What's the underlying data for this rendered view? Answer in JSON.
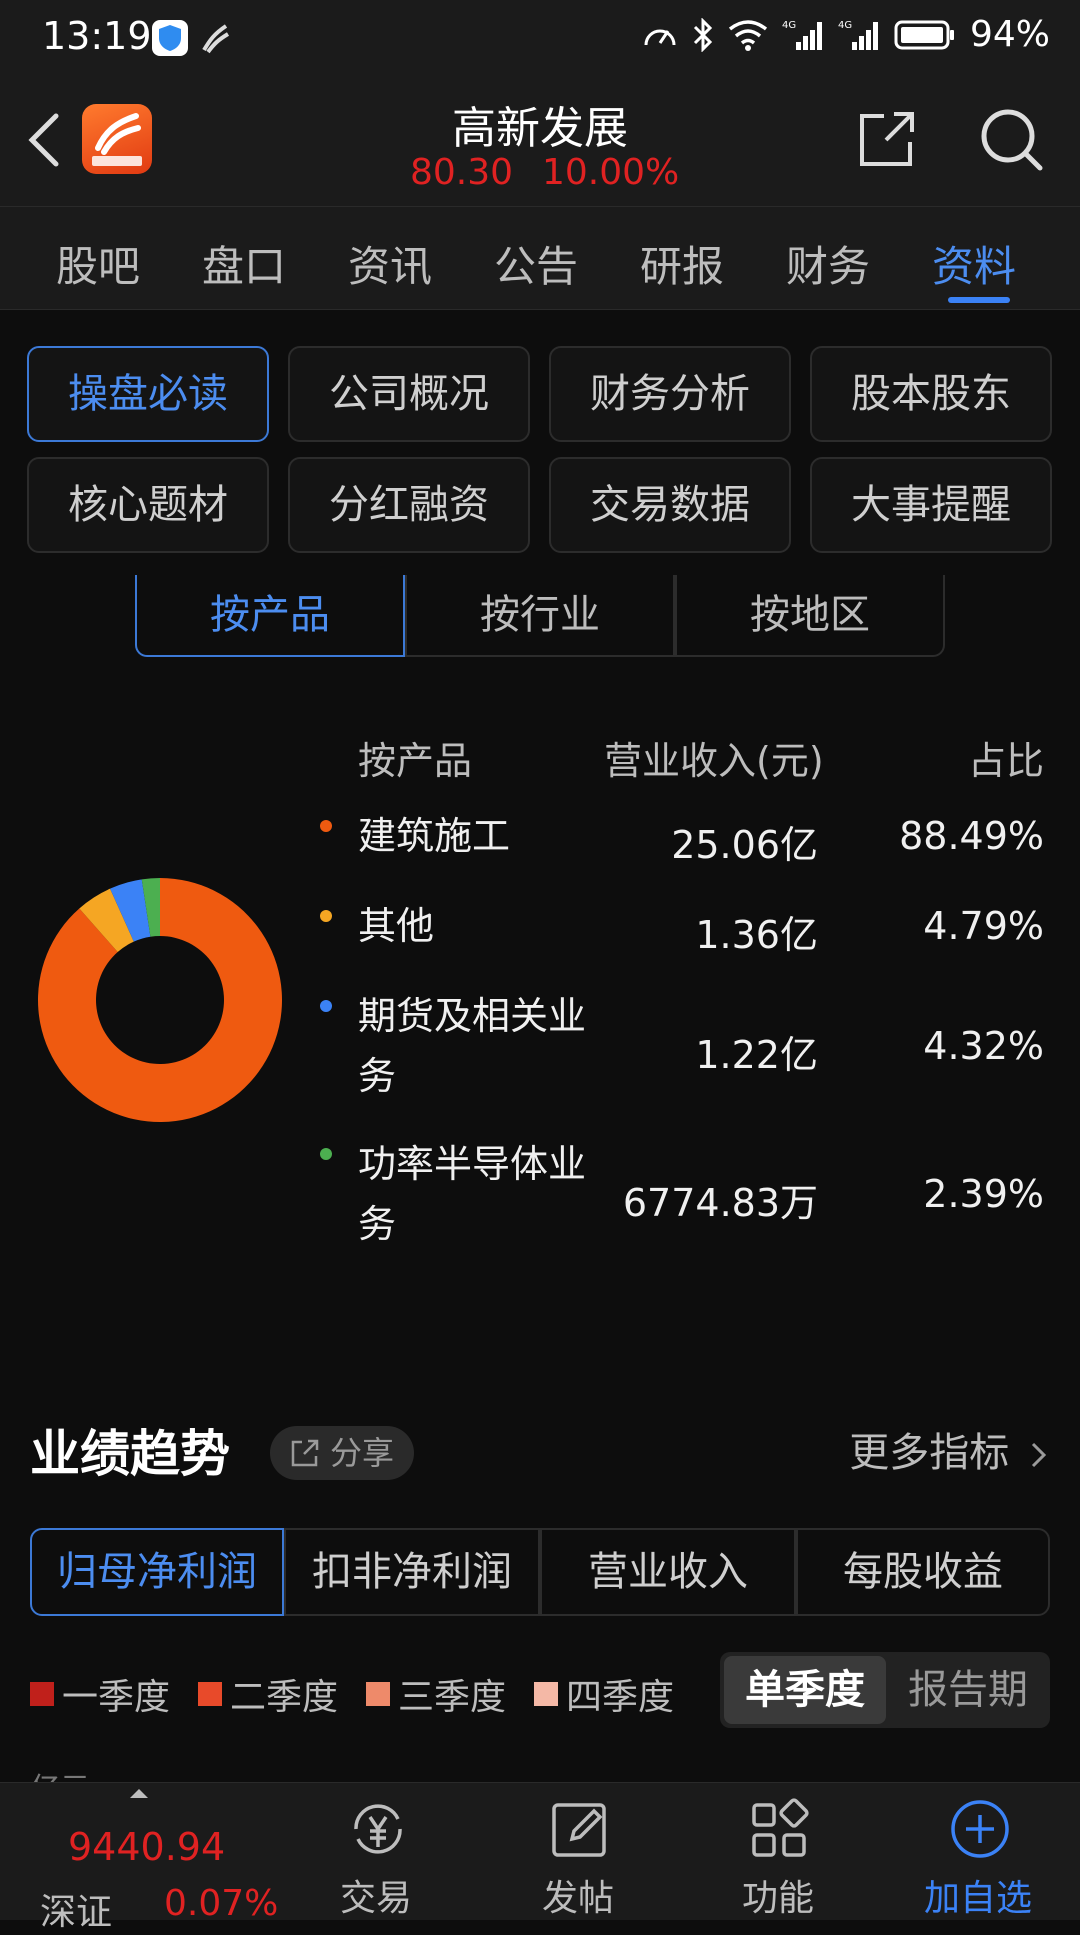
{
  "status": {
    "time": "13:19",
    "battery": "94%"
  },
  "header": {
    "title": "高新发展",
    "price": "80.30",
    "change": "10.00%"
  },
  "tabs": [
    "股吧",
    "盘口",
    "资讯",
    "公告",
    "研报",
    "财务",
    "资料"
  ],
  "grid_buttons": [
    "操盘必读",
    "公司概况",
    "财务分析",
    "股本股东",
    "核心题材",
    "分红融资",
    "交易数据",
    "大事提醒"
  ],
  "segments": [
    "按产品",
    "按行业",
    "按地区"
  ],
  "table": {
    "headers": [
      "按产品",
      "营业收入(元)",
      "占比"
    ],
    "rows": [
      {
        "name": "建筑施工",
        "value": "25.06亿",
        "pct": "88.49%",
        "color": "#ef5a10"
      },
      {
        "name": "其他",
        "value": "1.36亿",
        "pct": "4.79%",
        "color": "#f5a623"
      },
      {
        "name": "期货及相关业务",
        "value": "1.22亿",
        "pct": "4.32%",
        "color": "#3b82f6"
      },
      {
        "name": "功率半导体业务",
        "value": "6774.83万",
        "pct": "2.39%",
        "color": "#4caf50"
      }
    ]
  },
  "chart_data": {
    "type": "pie",
    "categories": [
      "建筑施工",
      "其他",
      "期货及相关业务",
      "功率半导体业务"
    ],
    "values": [
      88.49,
      4.79,
      4.32,
      2.39
    ],
    "colors": [
      "#ef5a10",
      "#f5a623",
      "#3b82f6",
      "#4caf50"
    ]
  },
  "trend": {
    "title": "业绩趋势",
    "share": "分享",
    "more": "更多指标",
    "tabs": [
      "归母净利润",
      "扣非净利润",
      "营业收入",
      "每股收益"
    ],
    "legend": [
      {
        "label": "一季度",
        "color": "#c0201b"
      },
      {
        "label": "二季度",
        "color": "#e84a2a"
      },
      {
        "label": "三季度",
        "color": "#ee8a6a"
      },
      {
        "label": "四季度",
        "color": "#f4b8a6"
      }
    ],
    "toggle": {
      "on": "单季度",
      "off": "报告期"
    },
    "axis_unit": "亿元"
  },
  "bottom": {
    "index_value": "9440.94",
    "index_name": "深证",
    "index_change": "0.07%",
    "items": [
      "交易",
      "发帖",
      "功能",
      "加自选"
    ]
  }
}
